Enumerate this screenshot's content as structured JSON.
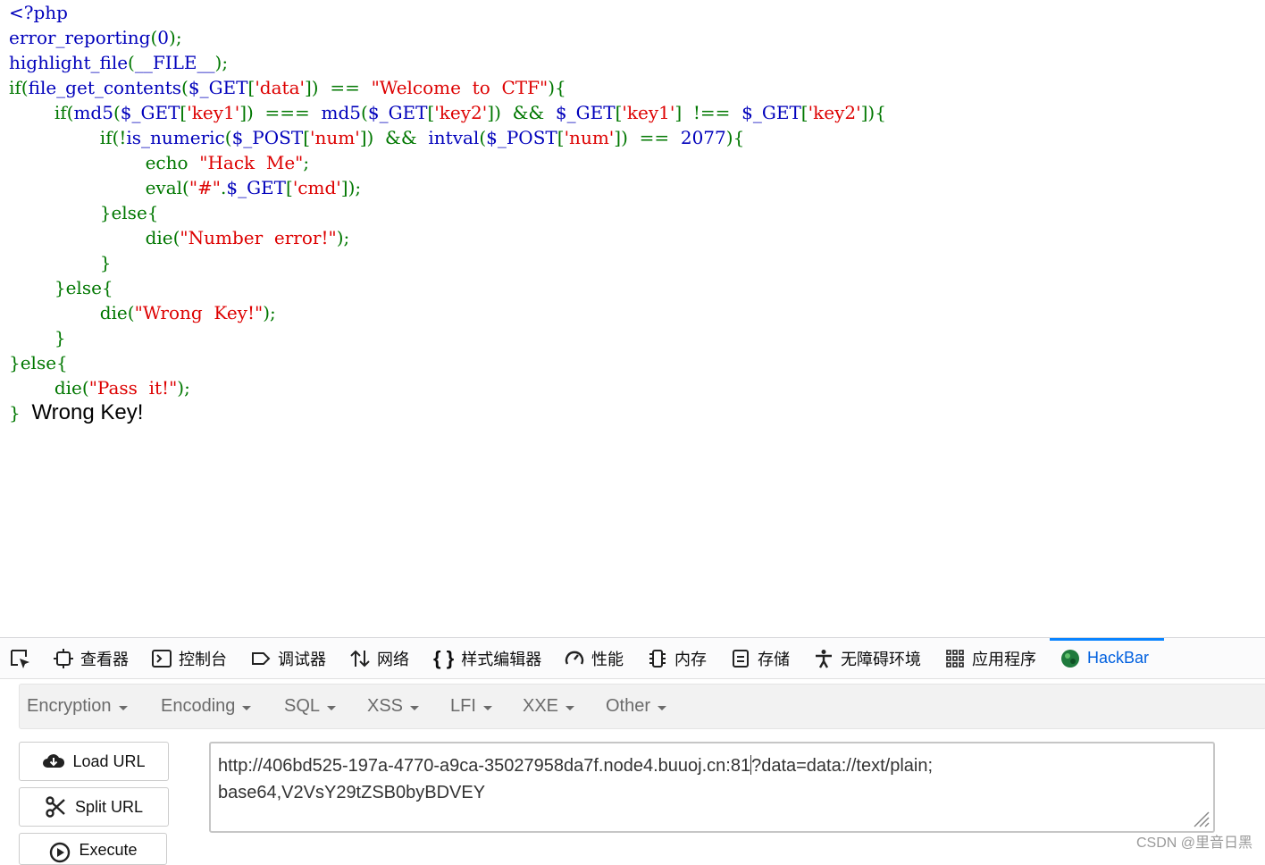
{
  "source": {
    "lines": [
      [
        {
          "c": "c-default",
          "t": "<?php"
        }
      ],
      [
        {
          "c": "c-default",
          "t": "error_reporting"
        },
        {
          "c": "c-keyword",
          "t": "("
        },
        {
          "c": "c-default",
          "t": "0"
        },
        {
          "c": "c-keyword",
          "t": ");"
        }
      ],
      [
        {
          "c": "c-default",
          "t": "highlight_file"
        },
        {
          "c": "c-keyword",
          "t": "("
        },
        {
          "c": "c-default",
          "t": "__FILE__"
        },
        {
          "c": "c-keyword",
          "t": ");"
        }
      ],
      [
        {
          "c": "c-keyword",
          "t": "if("
        },
        {
          "c": "c-default",
          "t": "file_get_contents"
        },
        {
          "c": "c-keyword",
          "t": "("
        },
        {
          "c": "c-default",
          "t": "$_GET"
        },
        {
          "c": "c-keyword",
          "t": "["
        },
        {
          "c": "c-string",
          "t": "'data'"
        },
        {
          "c": "c-keyword",
          "t": "])  ==  "
        },
        {
          "c": "c-string",
          "t": "\"Welcome  to  CTF\""
        },
        {
          "c": "c-keyword",
          "t": "){"
        }
      ],
      [
        {
          "c": "c-keyword",
          "t": "        if("
        },
        {
          "c": "c-default",
          "t": "md5"
        },
        {
          "c": "c-keyword",
          "t": "("
        },
        {
          "c": "c-default",
          "t": "$_GET"
        },
        {
          "c": "c-keyword",
          "t": "["
        },
        {
          "c": "c-string",
          "t": "'key1'"
        },
        {
          "c": "c-keyword",
          "t": "])  ===  "
        },
        {
          "c": "c-default",
          "t": "md5"
        },
        {
          "c": "c-keyword",
          "t": "("
        },
        {
          "c": "c-default",
          "t": "$_GET"
        },
        {
          "c": "c-keyword",
          "t": "["
        },
        {
          "c": "c-string",
          "t": "'key2'"
        },
        {
          "c": "c-keyword",
          "t": "])  &&  "
        },
        {
          "c": "c-default",
          "t": "$_GET"
        },
        {
          "c": "c-keyword",
          "t": "["
        },
        {
          "c": "c-string",
          "t": "'key1'"
        },
        {
          "c": "c-keyword",
          "t": "]  !==  "
        },
        {
          "c": "c-default",
          "t": "$_GET"
        },
        {
          "c": "c-keyword",
          "t": "["
        },
        {
          "c": "c-string",
          "t": "'key2'"
        },
        {
          "c": "c-keyword",
          "t": "]){"
        }
      ],
      [
        {
          "c": "c-keyword",
          "t": "                if(!"
        },
        {
          "c": "c-default",
          "t": "is_numeric"
        },
        {
          "c": "c-keyword",
          "t": "("
        },
        {
          "c": "c-default",
          "t": "$_POST"
        },
        {
          "c": "c-keyword",
          "t": "["
        },
        {
          "c": "c-string",
          "t": "'num'"
        },
        {
          "c": "c-keyword",
          "t": "])  &&  "
        },
        {
          "c": "c-default",
          "t": "intval"
        },
        {
          "c": "c-keyword",
          "t": "("
        },
        {
          "c": "c-default",
          "t": "$_POST"
        },
        {
          "c": "c-keyword",
          "t": "["
        },
        {
          "c": "c-string",
          "t": "'num'"
        },
        {
          "c": "c-keyword",
          "t": "])  ==  "
        },
        {
          "c": "c-default",
          "t": "2077"
        },
        {
          "c": "c-keyword",
          "t": "){"
        }
      ],
      [
        {
          "c": "c-keyword",
          "t": "                        echo  "
        },
        {
          "c": "c-string",
          "t": "\"Hack  Me\""
        },
        {
          "c": "c-keyword",
          "t": ";"
        }
      ],
      [
        {
          "c": "c-keyword",
          "t": "                        eval("
        },
        {
          "c": "c-string",
          "t": "\"#\""
        },
        {
          "c": "c-keyword",
          "t": "."
        },
        {
          "c": "c-default",
          "t": "$_GET"
        },
        {
          "c": "c-keyword",
          "t": "["
        },
        {
          "c": "c-string",
          "t": "'cmd'"
        },
        {
          "c": "c-keyword",
          "t": "]);"
        }
      ],
      [
        {
          "c": "c-keyword",
          "t": "                }else{"
        }
      ],
      [
        {
          "c": "c-keyword",
          "t": "                        die("
        },
        {
          "c": "c-string",
          "t": "\"Number  error!\""
        },
        {
          "c": "c-keyword",
          "t": ");"
        }
      ],
      [
        {
          "c": "c-keyword",
          "t": "                }"
        }
      ],
      [
        {
          "c": "c-keyword",
          "t": "        }else{"
        }
      ],
      [
        {
          "c": "c-keyword",
          "t": "                die("
        },
        {
          "c": "c-string",
          "t": "\"Wrong  Key!\""
        },
        {
          "c": "c-keyword",
          "t": ");"
        }
      ],
      [
        {
          "c": "c-keyword",
          "t": "        }"
        }
      ],
      [
        {
          "c": "c-keyword",
          "t": "}else{"
        }
      ],
      [
        {
          "c": "c-keyword",
          "t": "        die("
        },
        {
          "c": "c-string",
          "t": "\"Pass  it!\""
        },
        {
          "c": "c-keyword",
          "t": ");"
        }
      ],
      [
        {
          "c": "c-keyword",
          "t": "}"
        }
      ]
    ],
    "output": "Wrong Key!"
  },
  "devtools": {
    "tabs": [
      {
        "label": "查看器",
        "icon": "inspector-icon"
      },
      {
        "label": "控制台",
        "icon": "console-icon"
      },
      {
        "label": "调试器",
        "icon": "debugger-icon"
      },
      {
        "label": "网络",
        "icon": "network-icon"
      },
      {
        "label": "样式编辑器",
        "icon": "style-editor-icon"
      },
      {
        "label": "性能",
        "icon": "performance-icon"
      },
      {
        "label": "内存",
        "icon": "memory-icon"
      },
      {
        "label": "存储",
        "icon": "storage-icon"
      },
      {
        "label": "无障碍环境",
        "icon": "accessibility-icon"
      },
      {
        "label": "应用程序",
        "icon": "application-icon"
      },
      {
        "label": "HackBar",
        "icon": "hackbar-icon"
      }
    ],
    "active_tab": "HackBar"
  },
  "hackbar": {
    "menus": [
      "Encryption",
      "Encoding",
      "SQL",
      "XSS",
      "LFI",
      "XXE",
      "Other"
    ],
    "buttons": {
      "load": "Load URL",
      "split": "Split URL",
      "execute": "Execute"
    },
    "url_line1_before_cursor": "http://406bd525-197a-4770-a9ca-35027958da7f.node4.buuoj.cn:81",
    "url_line1_after_cursor": "?data=data://text/plain;",
    "url_line2": "base64,V2VsY29tZSB0byBDVEY"
  },
  "watermark": "CSDN @里音日黑",
  "colors": {
    "default": "#0000bb",
    "keyword": "#007700",
    "string": "#dd0000",
    "accent": "#0a84ff"
  }
}
